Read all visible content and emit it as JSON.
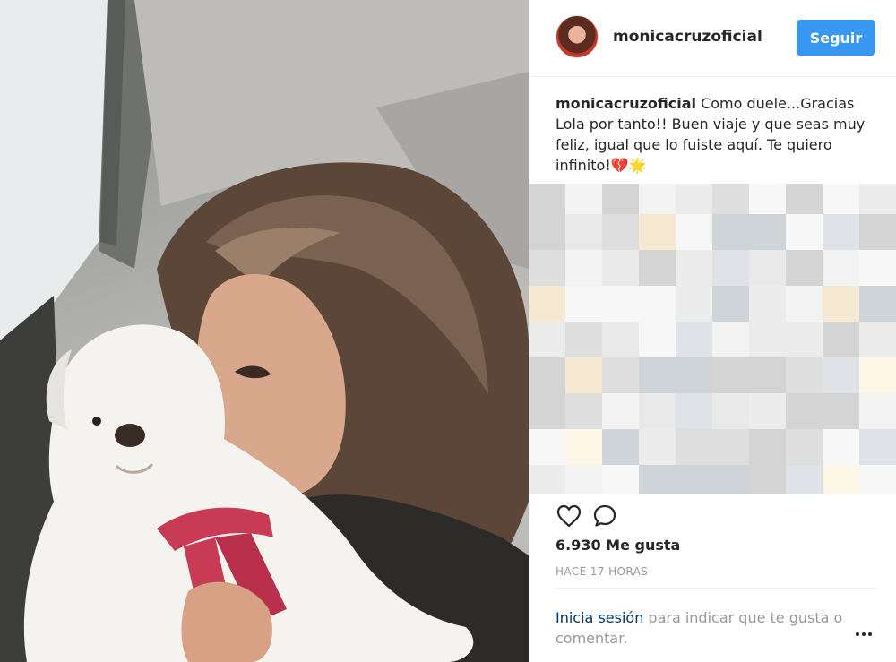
{
  "post": {
    "username": "monicacruzoficial",
    "follow_label": "Seguir",
    "caption_user": "monicacruzoficial",
    "caption_text": " Como duele...Gracias Lola por tanto!! Buen viaje y que seas muy feliz, igual que lo fuiste aquí. Te quiero infinito!💔🌟",
    "likes": "6.930 Me gusta",
    "time": "HACE 17 HORAS"
  },
  "login_prompt": {
    "link": "Inicia sesión",
    "text": " para indicar que te gusta o comentar."
  },
  "icons": {
    "like": "heart-icon",
    "comment": "comment-icon",
    "more": "more-options-icon"
  },
  "colors": {
    "follow_button": "#3897f0",
    "link": "#003569",
    "muted": "#999999"
  }
}
